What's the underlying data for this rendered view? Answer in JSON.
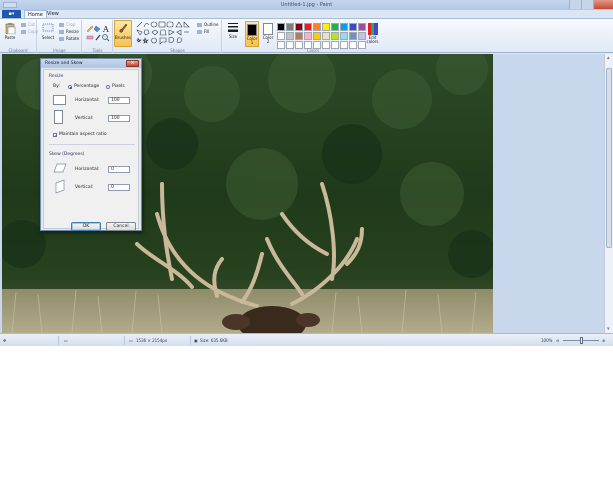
{
  "window": {
    "title": "Untitled-1.jpg - Paint",
    "file_tab": "",
    "tabs": [
      "Home",
      "View"
    ]
  },
  "ribbon": {
    "clipboard": {
      "label": "Clipboard",
      "paste": "Paste",
      "cut": "Cut",
      "copy": "Copy"
    },
    "image": {
      "label": "Image",
      "select": "Select",
      "crop": "Crop",
      "resize": "Resize",
      "rotate": "Rotate"
    },
    "tools": {
      "label": "Tools"
    },
    "brushes": {
      "label": "Brushes"
    },
    "shapes": {
      "label": "Shapes",
      "outline": "Outline",
      "fill": "Fill"
    },
    "size": {
      "label": "Size"
    },
    "colors": {
      "label": "Colors",
      "color1": "Color 1",
      "color2": "Color 2",
      "edit": "Edit colors",
      "palette": [
        "#000000",
        "#7f7f7f",
        "#880015",
        "#ed1c24",
        "#ff7f27",
        "#fff200",
        "#22b14c",
        "#00a2e8",
        "#3f48cc",
        "#a349a4",
        "#ffffff",
        "#c3c3c3",
        "#b97a57",
        "#ffaec9",
        "#ffc90e",
        "#efe4b0",
        "#b5e61d",
        "#99d9ea",
        "#7092be",
        "#c8bfe7",
        "#ffffff",
        "#ffffff",
        "#ffffff",
        "#ffffff",
        "#ffffff",
        "#ffffff",
        "#ffffff",
        "#ffffff",
        "#ffffff",
        "#ffffff"
      ]
    }
  },
  "dialog": {
    "title": "Resize and Skew",
    "close": "×",
    "resize_section": "Resize",
    "by_label": "By:",
    "percentage": "Percentage",
    "pixels": "Pixels",
    "horizontal_label": "Horizontal:",
    "horizontal_value": "100",
    "vertical_label": "Vertical:",
    "vertical_value": "100",
    "maintain_aspect": "Maintain aspect ratio",
    "skew_section": "Skew (Degrees)",
    "skew_horizontal_label": "Horizontal:",
    "skew_horizontal_value": "0",
    "skew_vertical_label": "Vertical:",
    "skew_vertical_value": "0",
    "ok": "OK",
    "cancel": "Cancel"
  },
  "statusbar": {
    "dimensions": "1536 × 2154px",
    "size": "Size: 635.6KB",
    "zoom": "100%"
  }
}
